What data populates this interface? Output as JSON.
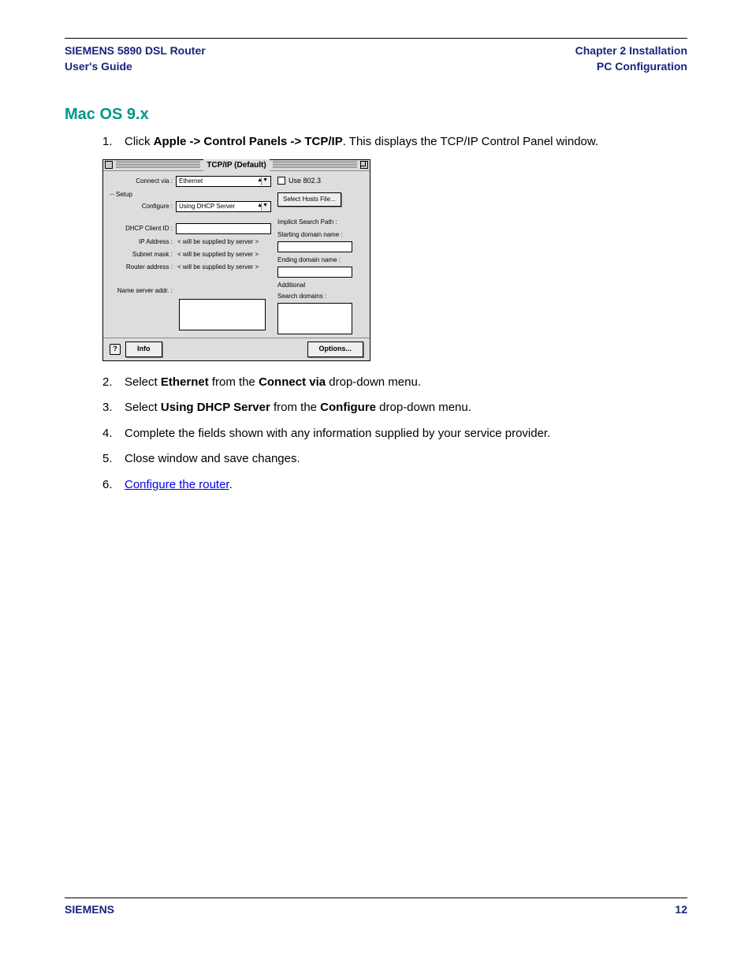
{
  "header": {
    "left1": "SIEMENS 5890 DSL Router",
    "left2": "User's Guide",
    "right1": "Chapter 2  Installation",
    "right2": "PC Configuration"
  },
  "section_title": "Mac OS 9.x",
  "steps": {
    "s1_num": "1.",
    "s1_a": "Click ",
    "s1_b": "Apple -> Control Panels -> TCP/IP",
    "s1_c": ". This displays the TCP/IP Control Panel window.",
    "s2_num": "2.",
    "s2_a": "Select ",
    "s2_b": "Ethernet",
    "s2_c": " from the ",
    "s2_d": "Connect via",
    "s2_e": " drop-down menu.",
    "s3_num": "3.",
    "s3_a": "Select ",
    "s3_b": "Using DHCP Server",
    "s3_c": " from the ",
    "s3_d": "Configure",
    "s3_e": " drop-down menu.",
    "s4_num": "4.",
    "s4": "Complete the fields shown with any information supplied by your service provider.",
    "s5_num": "5.",
    "s5": "Close window and save changes.",
    "s6_num": "6.",
    "s6_link": "Configure the router",
    "s6_dot": "."
  },
  "tcpip": {
    "title": "TCP/IP (Default)",
    "connect_via_lbl": "Connect via :",
    "connect_via_val": "Ethernet",
    "setup": "Setup",
    "configure_lbl": "Configure :",
    "configure_val": "Using DHCP Server",
    "dhcp_lbl": "DHCP Client ID :",
    "ip_lbl": "IP Address :",
    "subnet_lbl": "Subnet mask :",
    "router_lbl": "Router address :",
    "ns_lbl": "Name server addr. :",
    "supplied": "< will be supplied by server >",
    "use8023": "Use 802.3",
    "select_hosts": "Select Hosts File...",
    "implicit": "Implicit Search Path :",
    "starting": "Starting domain name :",
    "ending": "Ending domain name :",
    "additional": "Additional",
    "search_domains": "Search domains :",
    "info_btn": "Info",
    "options_btn": "Options...",
    "help": "?"
  },
  "footer": {
    "brand": "SIEMENS",
    "page": "12"
  }
}
